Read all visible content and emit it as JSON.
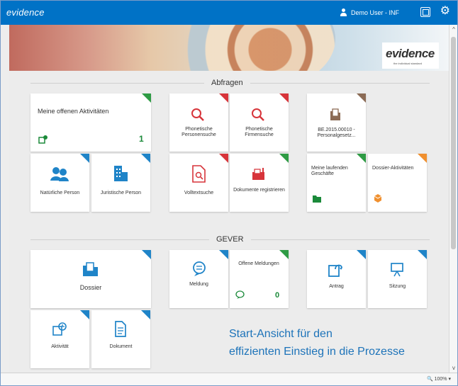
{
  "app": {
    "logo": "evidence",
    "user": "Demo User - INF",
    "brand": "evidence",
    "tagline": "the individual standard"
  },
  "sections": {
    "abfragen": "Abfragen",
    "gever": "GEVER"
  },
  "tiles": {
    "aktivitaeten": {
      "label": "Meine offenen Aktivitäten",
      "count": "1",
      "corner": "#2e9b44"
    },
    "personensuche": {
      "label": "Phonetische Personensuche",
      "corner": "#d7343a"
    },
    "firmensuche": {
      "label": "Phonetische Firmensuche",
      "corner": "#d7343a"
    },
    "dokument_be": {
      "label": "BE.2015.00010 - Personalgesetz...",
      "corner": "#8b6b55"
    },
    "natuerliche_person": {
      "label": "Natürliche Person",
      "corner": "#1f84c8"
    },
    "juristische_person": {
      "label": "Juristische Person",
      "corner": "#1f84c8"
    },
    "volltextsuche": {
      "label": "Volltextsuche",
      "corner": "#d7343a"
    },
    "dokumente_registrieren": {
      "label": "Dokumente registrieren",
      "corner": "#2e9b44"
    },
    "laufende_geschaefte": {
      "label": "Meine laufenden Geschäfte",
      "corner": "#2e9b44"
    },
    "dossier_aktivitaeten": {
      "label": "Dossier-Aktivitäten",
      "corner": "#f0902f"
    },
    "dossier": {
      "label": "Dossier",
      "corner": "#1f84c8"
    },
    "meldung": {
      "label": "Meldung",
      "corner": "#1f84c8"
    },
    "offene_meldungen": {
      "label": "Offene Meldungen",
      "count": "0",
      "corner": "#2e9b44"
    },
    "antrag": {
      "label": "Antrag",
      "corner": "#1f84c8"
    },
    "sitzung": {
      "label": "Sitzung",
      "corner": "#1f84c8"
    },
    "aktivitaet": {
      "label": "Aktivität",
      "corner": "#1f84c8"
    },
    "dokument": {
      "label": "Dokument",
      "corner": "#1f84c8"
    }
  },
  "hint": {
    "line1": "Start-Ansicht für den",
    "line2": "effizienten Einstieg in die Prozesse"
  },
  "status": {
    "zoom": "100%"
  },
  "icons": {
    "search": "search-icon",
    "person": "person-icon",
    "building": "building-icon",
    "document": "document-icon",
    "chat": "chat-icon",
    "presentation": "presentation-icon"
  }
}
